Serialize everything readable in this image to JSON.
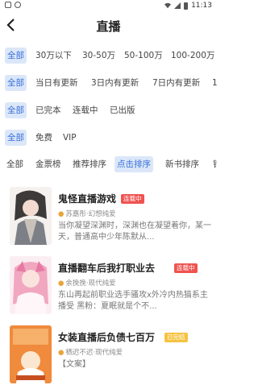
{
  "status_bar": {
    "time": "11:13"
  },
  "header": {
    "title": "直播",
    "back_glyph": "<"
  },
  "filters": {
    "word_count": [
      "全部",
      "30万以下",
      "30-50万",
      "50-100万",
      "100-200万"
    ],
    "update": [
      "全部",
      "当日有更新",
      "3日内有更新",
      "7日内有更新",
      "1"
    ],
    "status": [
      "全部",
      "已完本",
      "连载中",
      "已出版"
    ],
    "price": [
      "全部",
      "免费",
      "VIP"
    ],
    "sort": [
      "全部",
      "金票榜",
      "推荐排序",
      "点击排序",
      "新书排序",
      "错"
    ]
  },
  "books": [
    {
      "title": "鬼怪直播游戏",
      "tag": "连载中",
      "author": "苏嘉彤·幻想纯爱",
      "intro": "当你凝望深渊时，深渊也在凝望着你，某一天，普通高中少年陈默从..."
    },
    {
      "title": "直播翻车后我打职业去",
      "tag": "连载中",
      "author": "余挽挽·现代纯爱",
      "intro": "东山再起前职业选手骚攻x外冷内热猫系主播受 黑粉：夏眠就是个不..."
    },
    {
      "title": "女装直播后负债七百万",
      "tag": "已完结",
      "author": "栖迟不迟·现代纯爱",
      "intro": "【文案】"
    }
  ],
  "colors": {
    "accent": "#3a6fd8",
    "active_chip_bg": "#dbe7f9",
    "tag_serial": "#ef5350",
    "tag_finished": "#f5c341",
    "author_icon": "#e8a43a"
  }
}
